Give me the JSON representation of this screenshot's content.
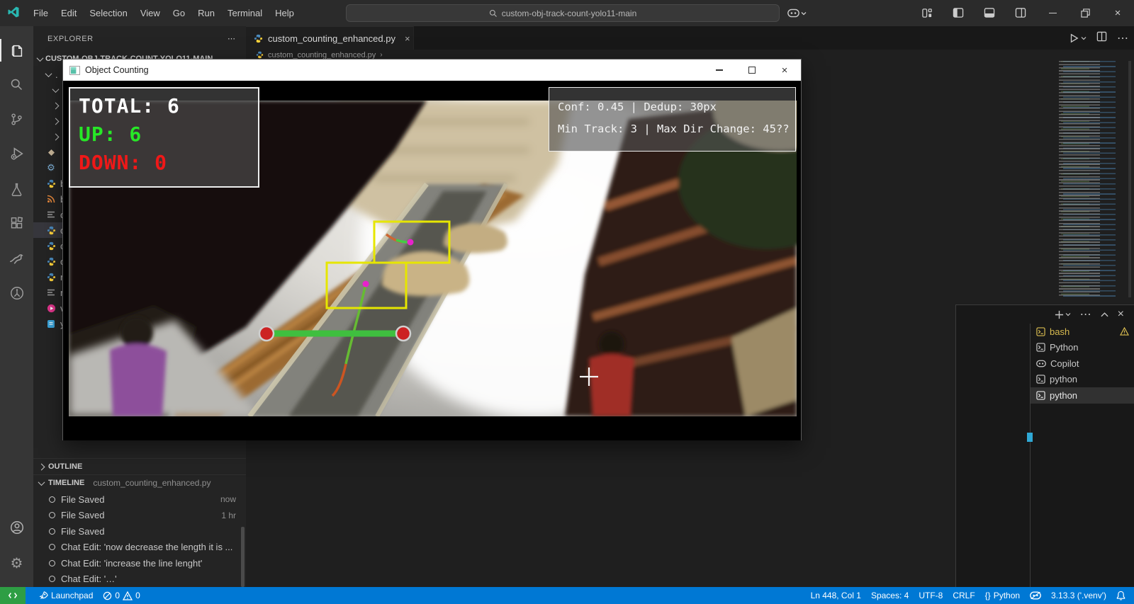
{
  "titlebar": {
    "menus": [
      "File",
      "Edit",
      "Selection",
      "View",
      "Go",
      "Run",
      "Terminal",
      "Help"
    ],
    "search_text": "custom-obj-track-count-yolo11-main"
  },
  "tabs": {
    "active": "custom_counting_enhanced.py"
  },
  "breadcrumb": {
    "file": "custom_counting_enhanced.py"
  },
  "explorer": {
    "header": "EXPLORER",
    "root": "CUSTOM-OBJ-TRACK-COUNT-YOLO11-MAIN",
    "folders": [
      {
        "state": "expanded",
        "label": "."
      },
      {
        "state": "expanded",
        "label": ""
      },
      {
        "state": "collapsed",
        "label": ""
      },
      {
        "state": "collapsed",
        "label": ""
      },
      {
        "state": "collapsed",
        "label": ""
      }
    ],
    "files": [
      {
        "icon": "diamond",
        "label": ""
      },
      {
        "icon": "gear",
        "label": ""
      },
      {
        "icon": "python",
        "label": "b"
      },
      {
        "icon": "rss",
        "label": "b"
      },
      {
        "icon": "text",
        "label": "c"
      },
      {
        "icon": "python",
        "label": "c"
      },
      {
        "icon": "python",
        "label": "c"
      },
      {
        "icon": "python",
        "label": "c"
      },
      {
        "icon": "python",
        "label": "r"
      },
      {
        "icon": "text",
        "label": "r"
      },
      {
        "icon": "video",
        "label": "v"
      },
      {
        "icon": "yaml",
        "label": "y"
      }
    ]
  },
  "outline": {
    "label": "OUTLINE"
  },
  "timeline": {
    "label": "TIMELINE",
    "file": "custom_counting_enhanced.py",
    "items": [
      {
        "label": "File Saved",
        "time": "now"
      },
      {
        "label": "File Saved",
        "time": "1 hr"
      },
      {
        "label": "File Saved",
        "time": ""
      },
      {
        "label": "Chat Edit: 'now decrease the length it is ...",
        "time": ""
      },
      {
        "label": "Chat Edit: 'increase the line lenght'",
        "time": ""
      },
      {
        "label": "Chat Edit: '…'",
        "time": ""
      }
    ]
  },
  "cv_window": {
    "title": "Object Counting",
    "stats": {
      "total": "TOTAL: 6",
      "up": "UP: 6",
      "down": "DOWN: 0"
    },
    "conf_line1": "Conf: 0.45 | Dedup: 30px",
    "conf_line2": "Min Track: 3 | Max Dir Change: 45??"
  },
  "terminal": {
    "tabs": [
      {
        "name": "bash",
        "warning": true
      },
      {
        "name": "Python"
      },
      {
        "name": "Copilot"
      },
      {
        "name": "python"
      },
      {
        "name": "python",
        "selected": true
      }
    ]
  },
  "statusbar": {
    "launchpad": "Launchpad",
    "errors": "0",
    "warnings": "0",
    "line_col": "Ln 448, Col 1",
    "indent": "Spaces: 4",
    "encoding": "UTF-8",
    "eol": "CRLF",
    "lang_braces": "{}",
    "language": "Python",
    "interpreter": "3.13.3 ('.venv')"
  },
  "colors": {
    "status_blue": "#0078d4",
    "remote_green": "#2e9e44",
    "up_green": "#27e827",
    "down_red": "#f01818",
    "bbox_yellow": "#e6e600",
    "count_line_green": "#3fbf3f",
    "endpoint_red": "#cc2222",
    "track_dot_magenta": "#e822cc"
  }
}
